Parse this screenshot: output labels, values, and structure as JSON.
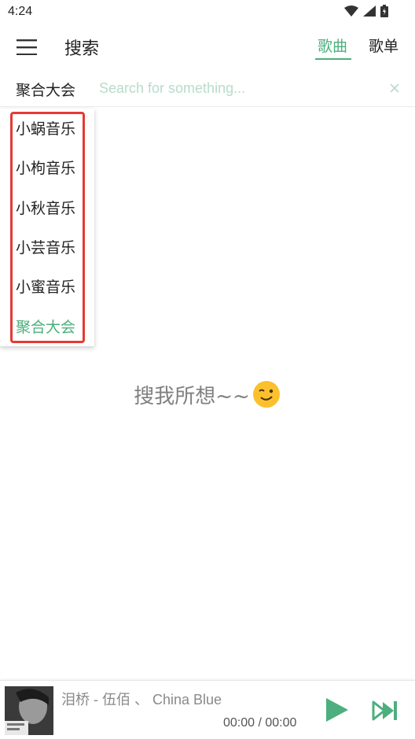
{
  "status_bar": {
    "time": "4:24"
  },
  "header": {
    "title": "搜索",
    "tabs": [
      {
        "label": "歌曲",
        "active": true
      },
      {
        "label": "歌单",
        "active": false
      }
    ]
  },
  "search": {
    "source_label": "聚合大会",
    "placeholder": "Search for something...",
    "value": ""
  },
  "dropdown": {
    "items": [
      {
        "label": "小蜗音乐",
        "selected": false
      },
      {
        "label": "小枸音乐",
        "selected": false
      },
      {
        "label": "小秋音乐",
        "selected": false
      },
      {
        "label": "小芸音乐",
        "selected": false
      },
      {
        "label": "小蜜音乐",
        "selected": false
      },
      {
        "label": "聚合大会",
        "selected": true
      }
    ]
  },
  "empty_state": {
    "text": "搜我所想~~",
    "emoji": "winking-face-icon"
  },
  "player": {
    "track": "泪桥 - 伍佰 、 China Blue",
    "time": "00:00 / 00:00"
  },
  "colors": {
    "accent": "#4caf7d",
    "highlight_border": "#e53935",
    "placeholder": "#b7dccb"
  }
}
